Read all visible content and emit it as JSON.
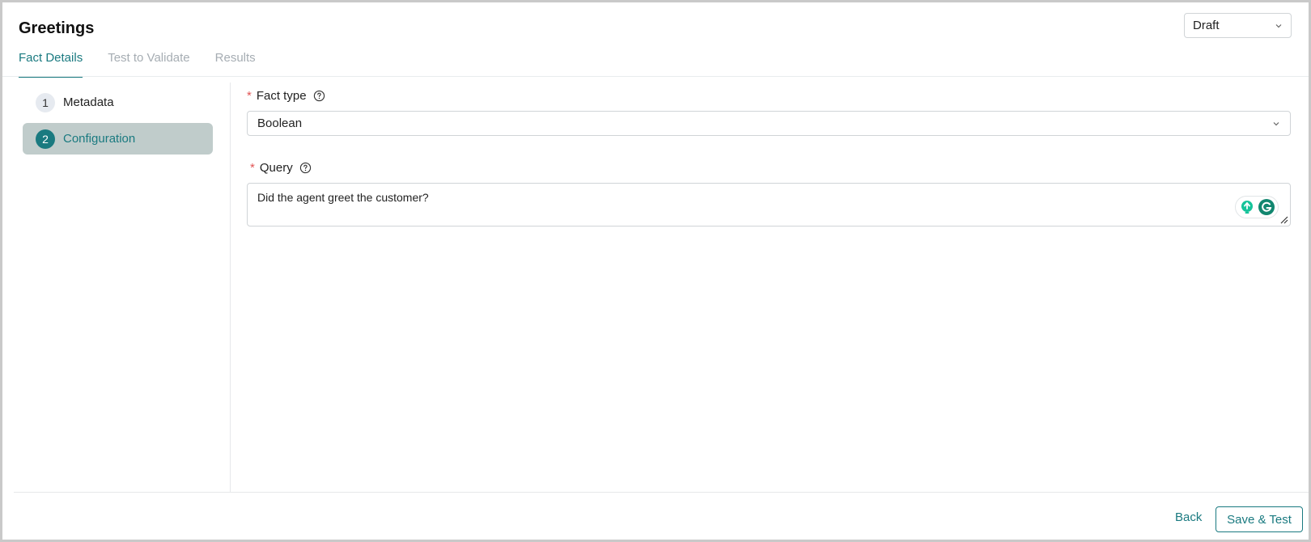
{
  "header": {
    "title": "Greetings",
    "status": {
      "selected": "Draft",
      "icon": "chevron-down-icon"
    }
  },
  "tabs": [
    {
      "label": "Fact Details",
      "active": true
    },
    {
      "label": "Test to Validate",
      "active": false
    },
    {
      "label": "Results",
      "active": false
    }
  ],
  "steps": [
    {
      "number": "1",
      "label": "Metadata",
      "active": false
    },
    {
      "number": "2",
      "label": "Configuration",
      "active": true
    }
  ],
  "form": {
    "fact_type": {
      "required_mark": "*",
      "label": "Fact type",
      "value": "Boolean",
      "help_icon": "question-circle-icon"
    },
    "query": {
      "required_mark": "*",
      "label": "Query",
      "value": "Did the agent greet the customer?",
      "help_icon": "question-circle-icon"
    }
  },
  "footer": {
    "back_label": "Back",
    "save_label": "Save & Test"
  },
  "colors": {
    "accent": "#1a7a80",
    "active_step_bg": "#c0cccb",
    "required": "#e25555",
    "inactive_tab": "#a6adb3"
  }
}
